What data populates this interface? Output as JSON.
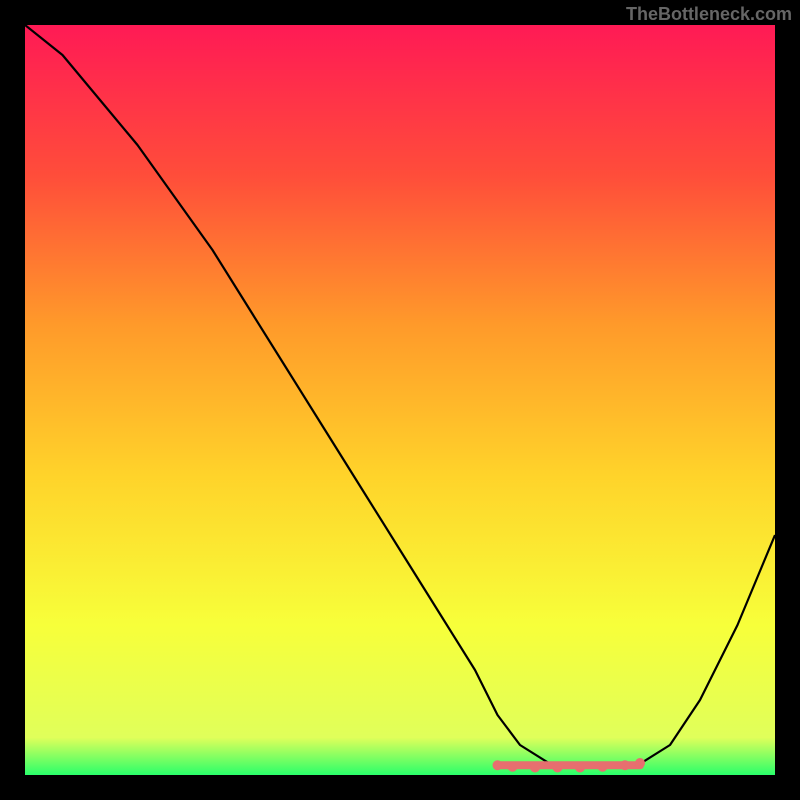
{
  "watermark": "TheBottleneck.com",
  "chart_data": {
    "type": "line",
    "title": "",
    "xlabel": "",
    "ylabel": "",
    "xlim": [
      0,
      100
    ],
    "ylim": [
      0,
      100
    ],
    "gradient_stops": [
      {
        "offset": 0,
        "color": "#ff1a55"
      },
      {
        "offset": 20,
        "color": "#ff4d3a"
      },
      {
        "offset": 40,
        "color": "#ff9a2a"
      },
      {
        "offset": 60,
        "color": "#ffd32a"
      },
      {
        "offset": 80,
        "color": "#f7ff3a"
      },
      {
        "offset": 95,
        "color": "#e0ff5a"
      },
      {
        "offset": 100,
        "color": "#2aff6a"
      }
    ],
    "series": [
      {
        "name": "curve",
        "x": [
          0,
          5,
          10,
          15,
          20,
          25,
          30,
          35,
          40,
          45,
          50,
          55,
          60,
          63,
          66,
          70,
          74,
          78,
          82,
          86,
          90,
          95,
          100
        ],
        "y": [
          100,
          96,
          90,
          84,
          77,
          70,
          62,
          54,
          46,
          38,
          30,
          22,
          14,
          8,
          4,
          1.5,
          1,
          1,
          1.5,
          4,
          10,
          20,
          32
        ]
      }
    ],
    "optimal_band": {
      "x0": 63,
      "x1": 82,
      "y": 1.3
    },
    "markers": [
      {
        "x": 63,
        "y": 1.3
      },
      {
        "x": 65,
        "y": 1.1
      },
      {
        "x": 68,
        "y": 1.0
      },
      {
        "x": 71,
        "y": 1.0
      },
      {
        "x": 74,
        "y": 1.0
      },
      {
        "x": 77,
        "y": 1.1
      },
      {
        "x": 80,
        "y": 1.3
      },
      {
        "x": 82,
        "y": 1.6
      }
    ]
  }
}
